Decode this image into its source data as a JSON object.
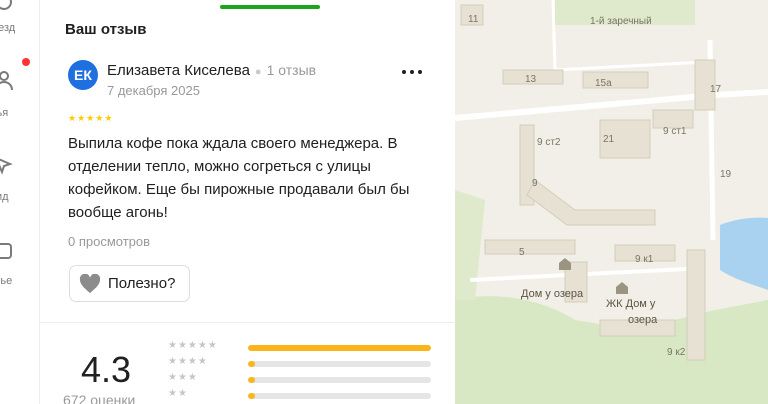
{
  "rail": {
    "items": [
      {
        "label": "резд",
        "icon": "route-icon"
      },
      {
        "label": "узья",
        "icon": "friends-icon"
      },
      {
        "label": "ид",
        "icon": "guide-icon"
      },
      {
        "label": "лье",
        "icon": "wallet-icon"
      }
    ]
  },
  "panel": {
    "section_title": "Ваш отзыв",
    "review": {
      "avatar_initials": "ЕК",
      "author": "Елизавета Киселева",
      "author_reviews": "1 отзыв",
      "date": "7 декабря 2025",
      "rating": 5,
      "text": "Выпила кофе пока ждала своего менеджера. В отделении тепло, можно согреться с улицы кофейком. Еще бы пирожные продавали был бы вообще агонь!",
      "views": "0 просмотров",
      "useful_label": "Полезно?"
    },
    "summary": {
      "rating": "4.3",
      "count_label": "672 оценки",
      "histogram": [
        {
          "stars": 5,
          "fraction": 1.0
        },
        {
          "stars": 4,
          "fraction": 0.04
        },
        {
          "stars": 3,
          "fraction": 0.04
        },
        {
          "stars": 2,
          "fraction": 0.04
        }
      ]
    }
  },
  "map": {
    "labels": [
      "11",
      "1-й заречный",
      "13",
      "15а",
      "17",
      "21",
      "9 ст2",
      "9 ст1",
      "9",
      "19",
      "5",
      "9 к1",
      "Дом у озера",
      "ЖК Дом у",
      "озера",
      "9 к2"
    ]
  },
  "colors": {
    "accent_green": "#1aa51a",
    "avatar_blue": "#1e6fe0",
    "star_yellow": "#ffcc00",
    "bar_yellow": "#fbb51b",
    "notification_red": "#ff3333"
  }
}
